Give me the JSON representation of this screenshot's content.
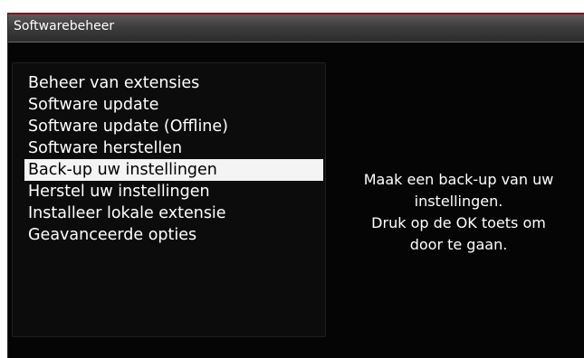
{
  "window": {
    "title": "Softwarebeheer"
  },
  "menu": {
    "items": [
      {
        "label": "Beheer van extensies",
        "selected": false
      },
      {
        "label": "Software update",
        "selected": false
      },
      {
        "label": "Software update (Offline)",
        "selected": false
      },
      {
        "label": "Software herstellen",
        "selected": false
      },
      {
        "label": "Back-up uw instellingen",
        "selected": true
      },
      {
        "label": "Herstel uw instellingen",
        "selected": false
      },
      {
        "label": "Installeer lokale extensie",
        "selected": false
      },
      {
        "label": "Geavanceerde opties",
        "selected": false
      }
    ]
  },
  "info": {
    "lines": [
      "Maak een back-up van uw",
      "instellingen.",
      "Druk op de OK toets om",
      "door te gaan."
    ]
  },
  "colors": {
    "accent_border": "#8c0f1a",
    "selection_background": "#f4f4f4",
    "background": "#000000",
    "text": "#ffffff"
  }
}
